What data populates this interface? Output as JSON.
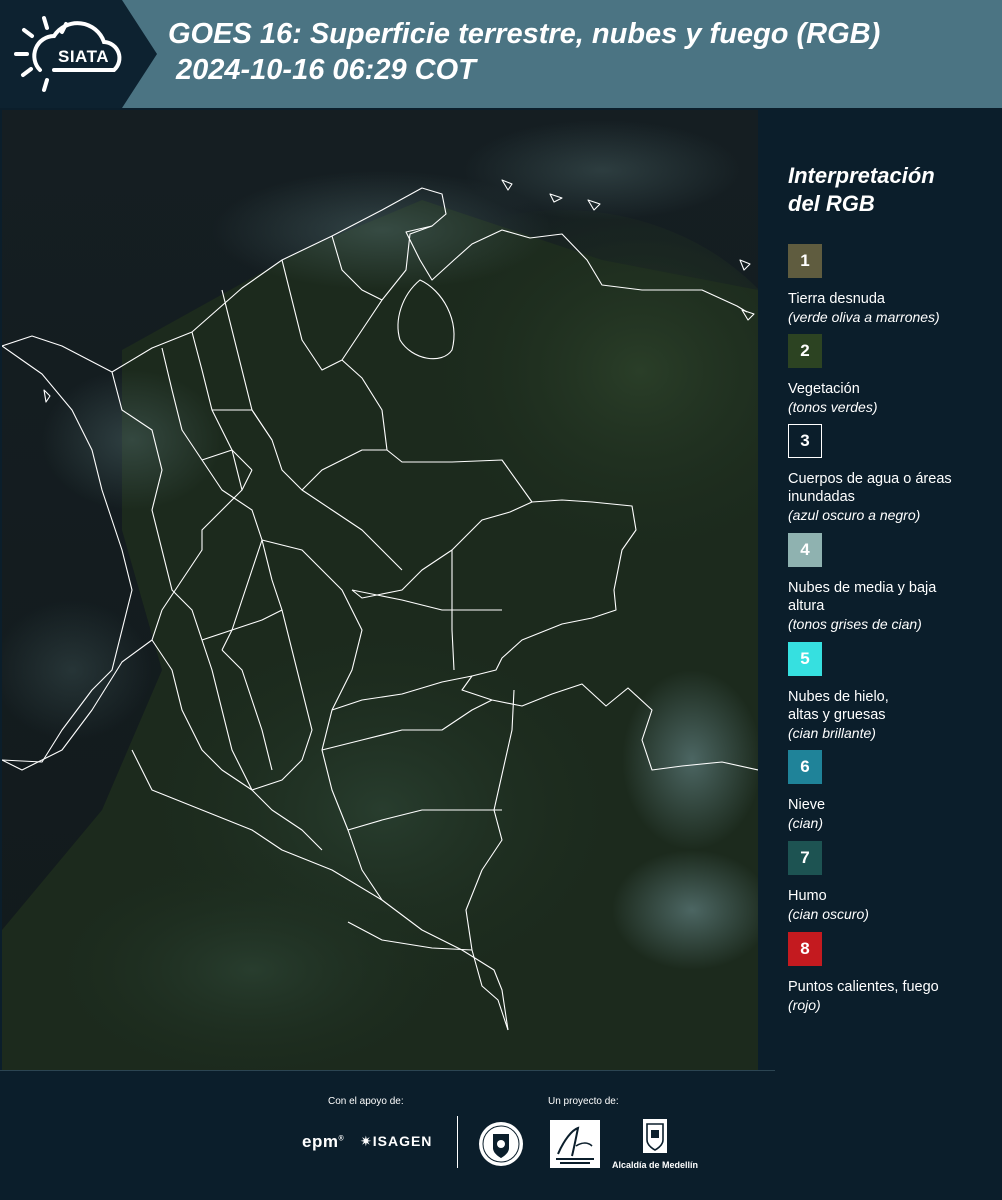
{
  "header": {
    "logo_text": "SIATA",
    "title_line1": "GOES 16: Superficie terrestre, nubes y fuego (RGB)",
    "title_line2": "2024-10-16 06:29 COT",
    "colors": {
      "band": "#4b7483",
      "dark": "#0d2230"
    }
  },
  "legend": {
    "title_line1": "Interpretación",
    "title_line2": "del RGB",
    "items": [
      {
        "number": "1",
        "label": "Tierra desnuda",
        "sub": "(verde oliva a marrones)",
        "color": "#5f5c3f",
        "border": "#5f5c3f"
      },
      {
        "number": "2",
        "label": "Vegetación",
        "sub": "(tonos verdes)",
        "color": "#2c4322",
        "border": "#2c4322"
      },
      {
        "number": "3",
        "label": "Cuerpos de agua o áreas inundadas",
        "sub": "(azul oscuro a negro)",
        "color": "#0b1e2b",
        "border": "#ffffff"
      },
      {
        "number": "4",
        "label": "Nubes de media y baja altura",
        "sub": "(tonos grises de cian)",
        "color": "#8fb2b0",
        "border": "#8fb2b0"
      },
      {
        "number": "5",
        "label": "Nubes de hielo, altas y gruesas",
        "sub": "(cian brillante)",
        "color": "#36e0e0",
        "border": "#36e0e0"
      },
      {
        "number": "6",
        "label": "Nieve",
        "sub": "(cian)",
        "color": "#1f8399",
        "border": "#1f8399"
      },
      {
        "number": "7",
        "label": "Humo",
        "sub": "(cian oscuro)",
        "color": "#1d5352",
        "border": "#1d5352"
      },
      {
        "number": "8",
        "label": "Puntos calientes, fuego",
        "sub": "(rojo)",
        "color": "#c41a1f",
        "border": "#c41a1f"
      }
    ]
  },
  "footer": {
    "support_label": "Con el apoyo de:",
    "project_label": "Un proyecto de:",
    "epm_logo": "epm",
    "isagen_logo": "ISAGEN",
    "alcaldia_label": "Alcaldía de Medellín"
  }
}
